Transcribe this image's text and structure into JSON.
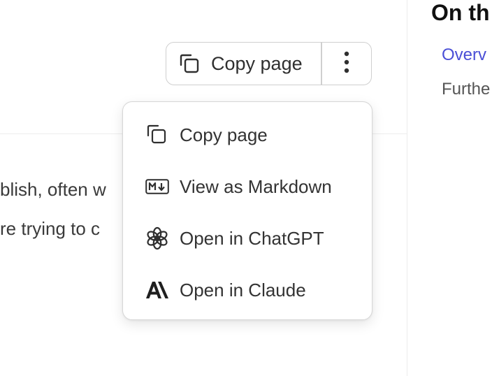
{
  "toc": {
    "title": "On th",
    "links": [
      {
        "label": "Overv"
      },
      {
        "label": "Furthe"
      }
    ]
  },
  "body": {
    "line1": "blish, often w",
    "line2": "re trying to c"
  },
  "copy_button": {
    "label": "Copy page"
  },
  "menu": {
    "items": [
      {
        "label": "Copy page",
        "icon": "copy-icon"
      },
      {
        "label": "View as Markdown",
        "icon": "markdown-icon"
      },
      {
        "label": "Open in ChatGPT",
        "icon": "chatgpt-icon"
      },
      {
        "label": "Open in Claude",
        "icon": "claude-icon"
      }
    ]
  },
  "colors": {
    "accent": "#4a4fd6",
    "border": "#cfcfcf",
    "text": "#333333"
  }
}
